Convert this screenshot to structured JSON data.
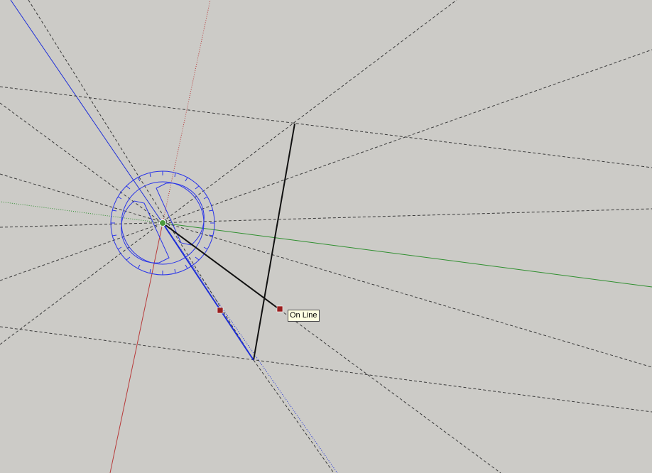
{
  "viewport": {
    "background": "#cccbc7"
  },
  "tooltip": {
    "text": "On Line"
  },
  "colors": {
    "red_axis": "#b83a3a",
    "green_axis": "#2f8f2f",
    "blue_axis": "#1f2fd8",
    "guide": "#3a3a3a",
    "edge": "#111111",
    "protractor": "#2a35e8",
    "grip": "#9a1d1d",
    "origin": "#4c9a3c"
  },
  "icons": {
    "protractor": "protractor-icon",
    "endpoint": "endpoint-grip-icon",
    "origin": "origin-point-icon"
  }
}
